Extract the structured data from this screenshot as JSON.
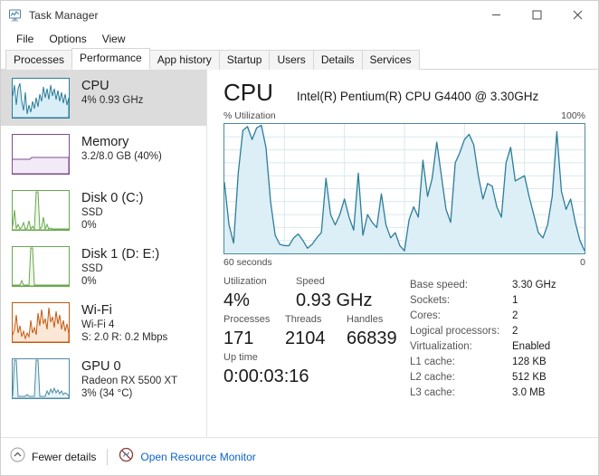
{
  "window": {
    "title": "Task Manager",
    "icon": "task-manager-icon",
    "controls": {
      "minimize": "minimize-icon",
      "maximize": "maximize-icon",
      "close": "close-icon"
    }
  },
  "menu": {
    "items": [
      {
        "label": "File"
      },
      {
        "label": "Options"
      },
      {
        "label": "View"
      }
    ]
  },
  "tabs": [
    {
      "label": "Processes",
      "active": false
    },
    {
      "label": "Performance",
      "active": true
    },
    {
      "label": "App history",
      "active": false
    },
    {
      "label": "Startup",
      "active": false
    },
    {
      "label": "Users",
      "active": false
    },
    {
      "label": "Details",
      "active": false
    },
    {
      "label": "Services",
      "active": false
    }
  ],
  "sidebar": {
    "items": [
      {
        "name": "cpu",
        "title": "CPU",
        "sub1": "4%  0.93 GHz",
        "sub2": "",
        "selected": true,
        "color": "#2d7d9a",
        "fill": "#d9eef6"
      },
      {
        "name": "memory",
        "title": "Memory",
        "sub1": "3.2/8.0 GB (40%)",
        "sub2": "",
        "selected": false,
        "color": "#7d4e8c",
        "fill": "#f2eaf6"
      },
      {
        "name": "disk-0",
        "title": "Disk 0 (C:)",
        "sub1": "SSD",
        "sub2": "0%",
        "selected": false,
        "color": "#6aa84f",
        "fill": "#eef7e9"
      },
      {
        "name": "disk-1",
        "title": "Disk 1 (D: E:)",
        "sub1": "SSD",
        "sub2": "0%",
        "selected": false,
        "color": "#6aa84f",
        "fill": "#eef7e9"
      },
      {
        "name": "wifi",
        "title": "Wi-Fi",
        "sub1": "Wi-Fi 4",
        "sub2": "S: 2.0 R: 0.2 Mbps",
        "selected": false,
        "color": "#c55a11",
        "fill": "#fbe7d7"
      },
      {
        "name": "gpu-0",
        "title": "GPU 0",
        "sub1": "Radeon RX 5500 XT",
        "sub2": "3%  (34 °C)",
        "selected": false,
        "color": "#4d8ba3",
        "fill": "#e8f3f8"
      }
    ]
  },
  "main": {
    "title": "CPU",
    "subtitle": "Intel(R) Pentium(R) CPU G4400 @ 3.30GHz",
    "axis_y_label": "% Utilization",
    "axis_y_max": "100%",
    "axis_x_left": "60 seconds",
    "axis_x_right": "0",
    "stats": {
      "utilization": {
        "label": "Utilization",
        "value": "4%"
      },
      "speed": {
        "label": "Speed",
        "value": "0.93 GHz"
      },
      "processes": {
        "label": "Processes",
        "value": "171"
      },
      "threads": {
        "label": "Threads",
        "value": "2104"
      },
      "handles": {
        "label": "Handles",
        "value": "66839"
      },
      "uptime": {
        "label": "Up time",
        "value": "0:00:03:16"
      }
    },
    "specs": [
      {
        "key": "Base speed:",
        "value": "3.30 GHz"
      },
      {
        "key": "Sockets:",
        "value": "1"
      },
      {
        "key": "Cores:",
        "value": "2"
      },
      {
        "key": "Logical processors:",
        "value": "2"
      },
      {
        "key": "Virtualization:",
        "value": "Enabled"
      },
      {
        "key": "L1 cache:",
        "value": "128 KB"
      },
      {
        "key": "L2 cache:",
        "value": "512 KB"
      },
      {
        "key": "L3 cache:",
        "value": "3.0 MB"
      }
    ]
  },
  "statusbar": {
    "fewer_details": {
      "label": "Fewer details",
      "icon": "chevron-up-circle-icon"
    },
    "resource_monitor": {
      "label": "Open Resource Monitor",
      "icon": "resource-monitor-icon"
    }
  },
  "chart_data": {
    "type": "area",
    "title": "% Utilization",
    "xlabel": "60 seconds",
    "ylabel": "% Utilization",
    "ylim": [
      0,
      100
    ],
    "xlim": [
      60,
      0
    ],
    "grid": true,
    "grid_rows": 10,
    "grid_cols": 6,
    "line_color": "#2d7d9a",
    "fill_color": "#dceef6",
    "series": [
      {
        "name": "CPU utilization",
        "values": [
          55,
          22,
          8,
          62,
          95,
          98,
          88,
          97,
          99,
          82,
          40,
          14,
          7,
          6,
          6,
          12,
          15,
          10,
          4,
          7,
          12,
          16,
          58,
          30,
          22,
          30,
          42,
          28,
          18,
          62,
          14,
          30,
          24,
          20,
          46,
          22,
          12,
          16,
          6,
          2,
          26,
          36,
          28,
          72,
          44,
          58,
          86,
          60,
          34,
          24,
          70,
          78,
          88,
          92,
          84,
          60,
          42,
          54,
          52,
          36,
          28,
          70,
          82,
          56,
          58,
          60,
          44,
          30,
          16,
          12,
          22,
          44,
          94,
          48,
          34,
          42,
          24,
          10,
          2
        ]
      }
    ]
  }
}
